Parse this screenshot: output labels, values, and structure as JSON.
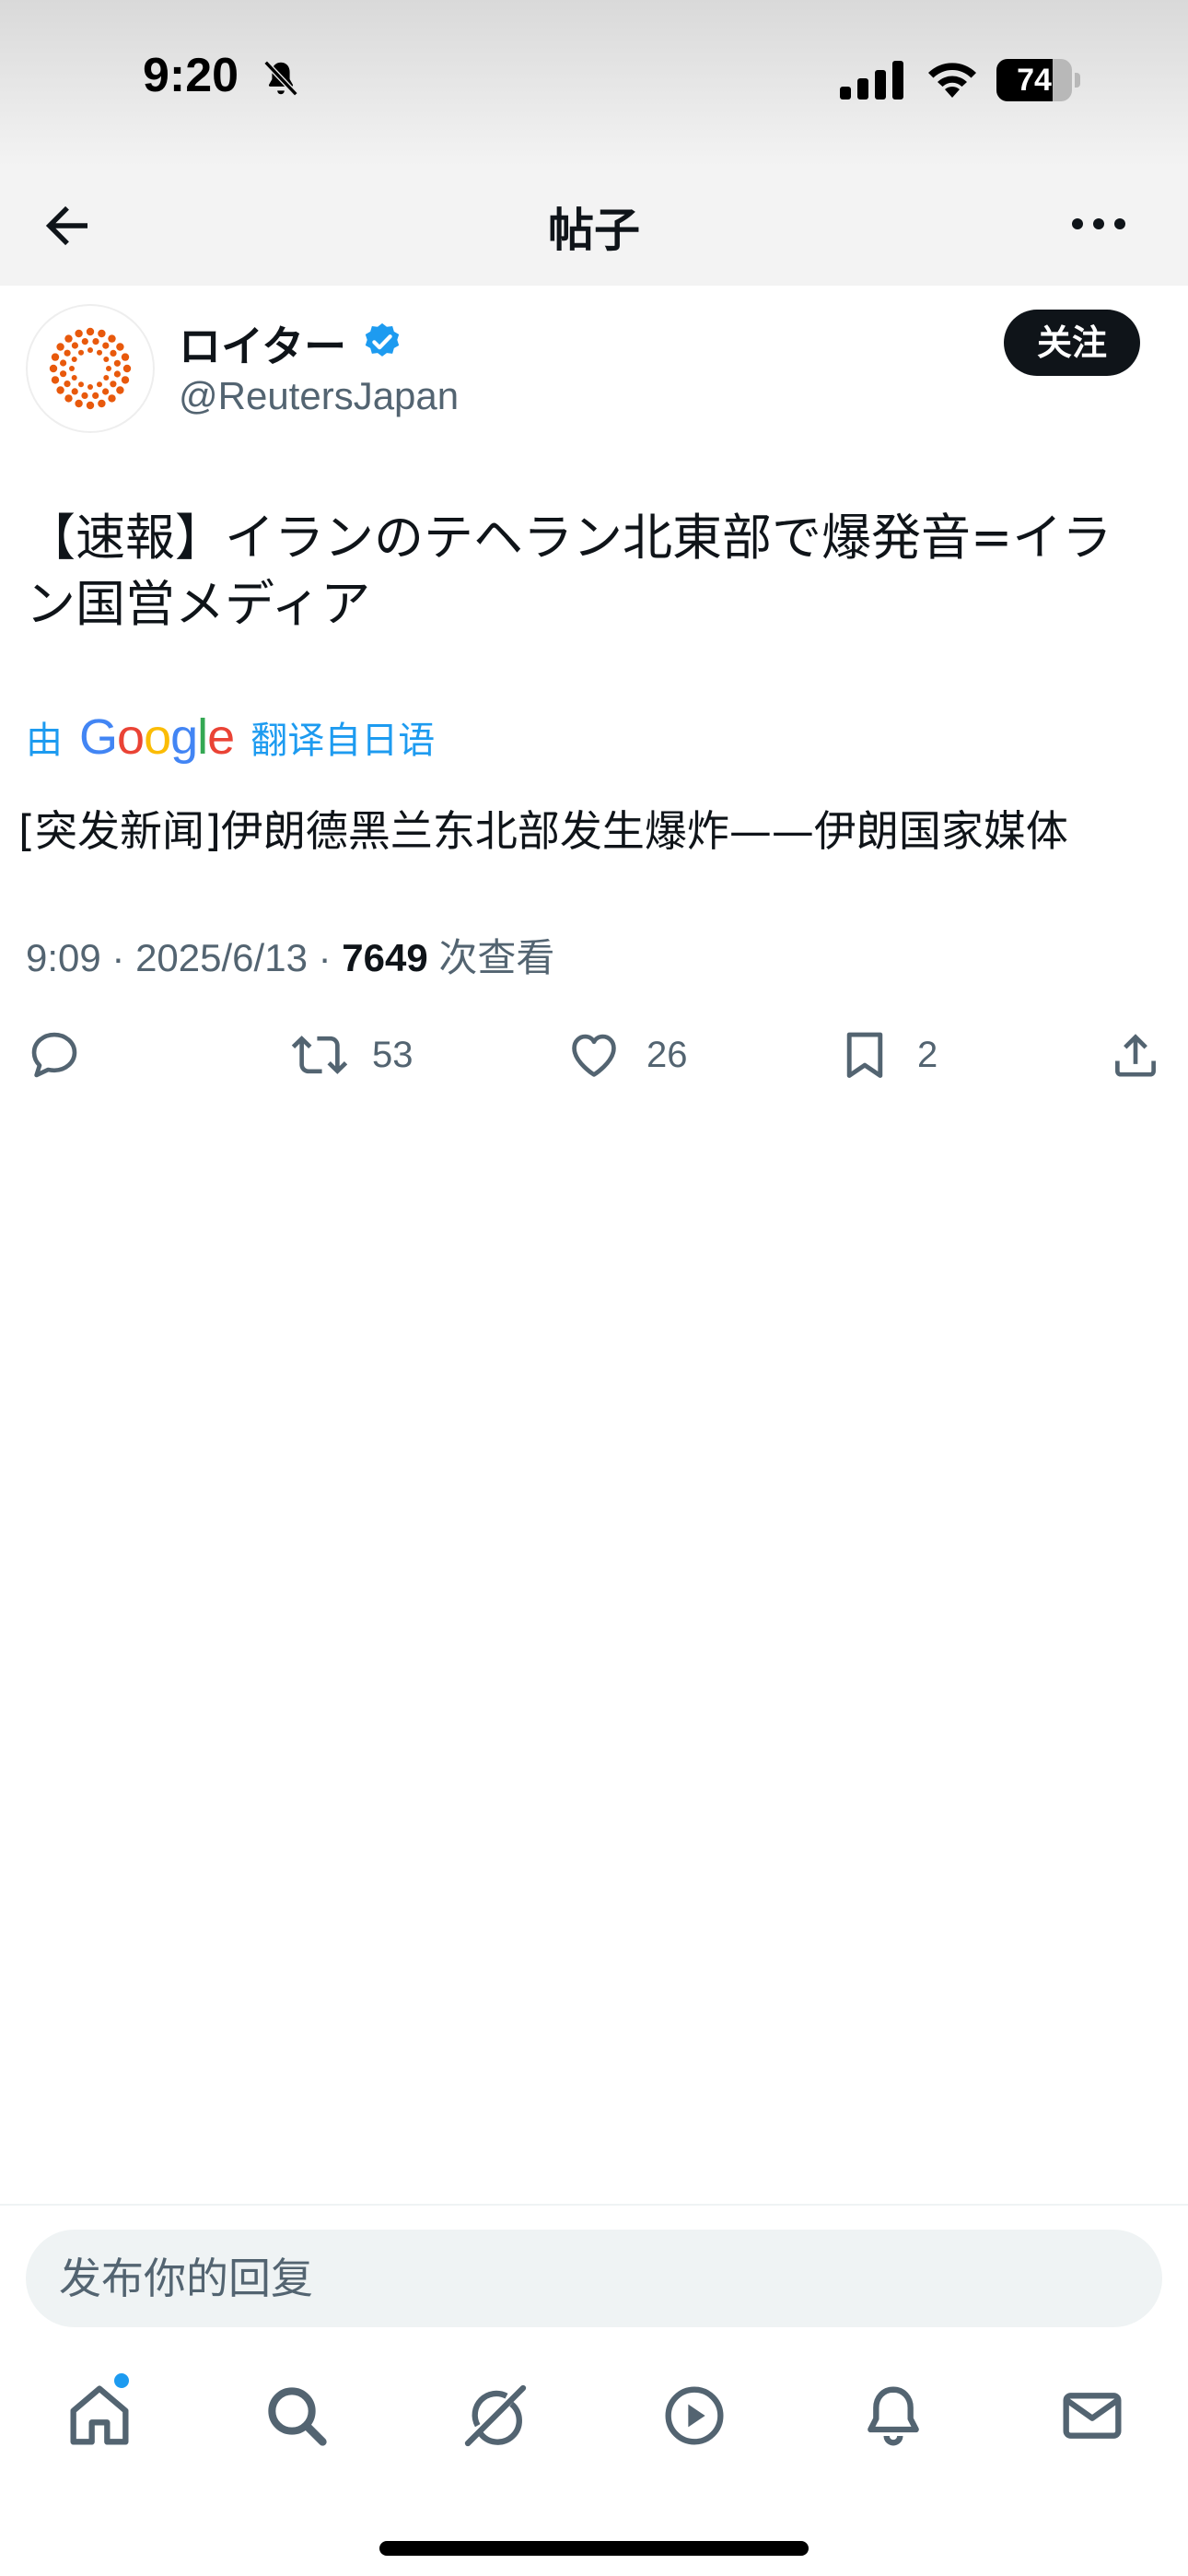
{
  "status_bar": {
    "time": "9:20",
    "battery_percent": "74",
    "battery_level": 0.74,
    "icons": [
      "bell-off-icon",
      "signal-icon",
      "wifi-icon",
      "battery-icon"
    ]
  },
  "header": {
    "title": "帖子",
    "back_icon": "arrow-left-icon",
    "more_icon": "more-horizontal-icon"
  },
  "author": {
    "name": "ロイター",
    "handle": "@ReutersJapan",
    "verified": true,
    "follow_label": "关注"
  },
  "post": {
    "text": "【速報】イランのテヘラン北東部で爆発音=イラン国営メディア",
    "translation_by": "由",
    "translation_provider": "Google",
    "translation_from": "翻译自日语",
    "translated_text": "[突发新闻]伊朗德黑兰东北部发生爆炸——伊朗国家媒体",
    "time": "9:09",
    "date": "2025/6/13",
    "views_count": "7649",
    "views_label": "次查看"
  },
  "actions": {
    "reply_count": "",
    "repost_count": "53",
    "like_count": "26",
    "bookmark_count": "2"
  },
  "reply": {
    "placeholder": "发布你的回复"
  },
  "tabs": {
    "items": [
      "home-icon",
      "search-icon",
      "grok-icon",
      "video-icon",
      "notifications-icon",
      "messages-icon"
    ],
    "home_has_badge": true
  },
  "colors": {
    "accent": "#1d9bf0",
    "text": "#0f1419",
    "secondary": "#536471",
    "reuters_orange": "#e8590c"
  }
}
